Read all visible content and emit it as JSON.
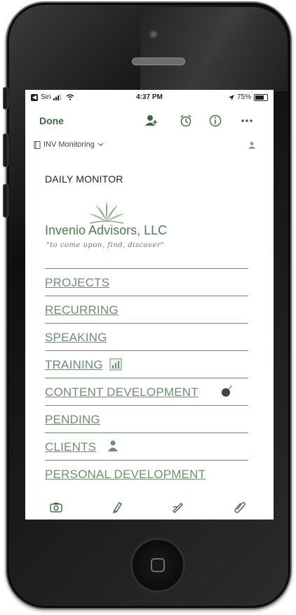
{
  "status_bar": {
    "back_label": "Siri",
    "time": "4:37 PM",
    "battery": "75%",
    "battery_level": 0.75
  },
  "toolbar": {
    "done_label": "Done",
    "icons": [
      "add-person-icon",
      "alarm-icon",
      "info-icon",
      "more-icon"
    ]
  },
  "notebook": {
    "name": "INV Monitoring"
  },
  "note": {
    "title": "DAILY MONITOR",
    "logo": {
      "company": "Invenio Advisors, LLC",
      "tagline": "\"to come upon, find, discover\""
    },
    "links": [
      {
        "label": "PROJECTS"
      },
      {
        "label": "RECURRING"
      },
      {
        "label": "SPEAKING"
      },
      {
        "label": "TRAINING"
      },
      {
        "label": "CONTENT DEVELOPMENT"
      },
      {
        "label": "PENDING"
      },
      {
        "label": "CLIENTS"
      },
      {
        "label": "PERSONAL DEVELOPMENT"
      }
    ]
  },
  "bottom_bar": {
    "icons": [
      "camera-icon",
      "pen-icon",
      "pencil-icon",
      "paperclip-icon"
    ]
  },
  "colors": {
    "accent": "#3f6a3f",
    "link": "#6d8f6d"
  }
}
